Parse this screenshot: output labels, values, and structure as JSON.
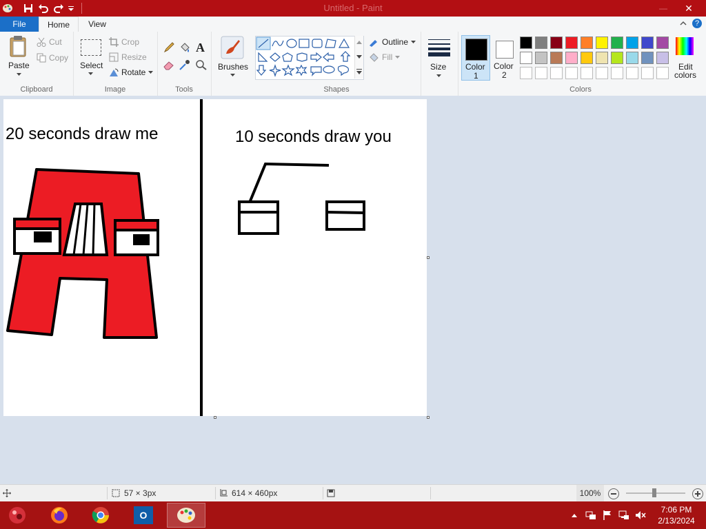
{
  "window": {
    "title": "Untitled - Paint"
  },
  "title_controls": {
    "minimize": "—",
    "close": "✕"
  },
  "tabs": {
    "file": "File",
    "home": "Home",
    "view": "View"
  },
  "ribbon": {
    "clipboard": {
      "paste": "Paste",
      "cut": "Cut",
      "copy": "Copy",
      "label": "Clipboard"
    },
    "image": {
      "select": "Select",
      "crop": "Crop",
      "resize": "Resize",
      "rotate": "Rotate",
      "label": "Image"
    },
    "tools": {
      "label": "Tools"
    },
    "brushes": {
      "label": "Brushes"
    },
    "shapes": {
      "outline": "Outline",
      "fill": "Fill",
      "label": "Shapes"
    },
    "size": {
      "label": "Size"
    },
    "color1": {
      "line1": "Color",
      "line2": "1"
    },
    "color2": {
      "line1": "Color",
      "line2": "2"
    },
    "colors": {
      "label": "Colors",
      "edit_line1": "Edit",
      "edit_line2": "colors",
      "row1": [
        "#000000",
        "#7f7f7f",
        "#880015",
        "#ed1c24",
        "#ff7f27",
        "#fff200",
        "#22b14c",
        "#00a2e8",
        "#3f48cc",
        "#a349a4"
      ],
      "row2": [
        "#ffffff",
        "#c3c3c3",
        "#b97a57",
        "#ffaec9",
        "#ffc90e",
        "#efe4b0",
        "#b5e61d",
        "#99d9ea",
        "#7092be",
        "#c8bfe7"
      ]
    }
  },
  "canvas": {
    "left_caption": "20 seconds draw me",
    "right_caption": "10 seconds draw you"
  },
  "status": {
    "selection_size": "57 × 3px",
    "image_size": "614 × 460px",
    "zoom": "100%"
  },
  "taskbar": {
    "outlook_letter": "O",
    "time": "7:06 PM",
    "date": "2/13/2024"
  }
}
